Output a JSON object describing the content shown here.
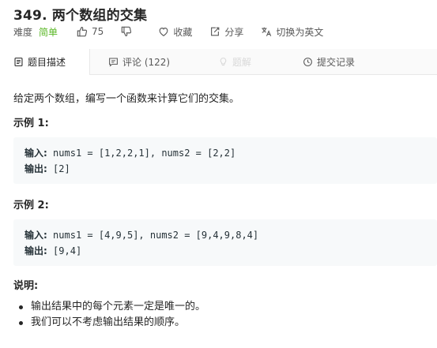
{
  "title": "349. 两个数组的交集",
  "meta": {
    "difficulty_label": "难度",
    "difficulty_value": "简单",
    "difficulty_color": "#5ab726",
    "likes": "75",
    "favorite_label": "收藏",
    "share_label": "分享",
    "translate_label": "切换为英文"
  },
  "tabs": [
    {
      "label": "题目描述",
      "icon": "document-icon",
      "active": true
    },
    {
      "label": "评论 (122)",
      "icon": "comment-icon",
      "active": false
    },
    {
      "label": "题解",
      "icon": "solution-icon",
      "disabled": true
    },
    {
      "label": "提交记录",
      "icon": "clock-icon",
      "active": false
    }
  ],
  "problem": {
    "description": "给定两个数组，编写一个函数来计算它们的交集。",
    "examples": [
      {
        "heading": "示例 1:",
        "input_label": "输入:",
        "input": "nums1 = [1,2,2,1], nums2 = [2,2]",
        "output_label": "输出:",
        "output": "[2]"
      },
      {
        "heading": "示例 2:",
        "input_label": "输入:",
        "input": "nums1 = [4,9,5], nums2 = [9,4,9,8,4]",
        "output_label": "输出:",
        "output": "[9,4]"
      }
    ],
    "notes_heading": "说明:",
    "notes": [
      "输出结果中的每个元素一定是唯一的。",
      "我们可以不考虑输出结果的顺序。"
    ]
  }
}
